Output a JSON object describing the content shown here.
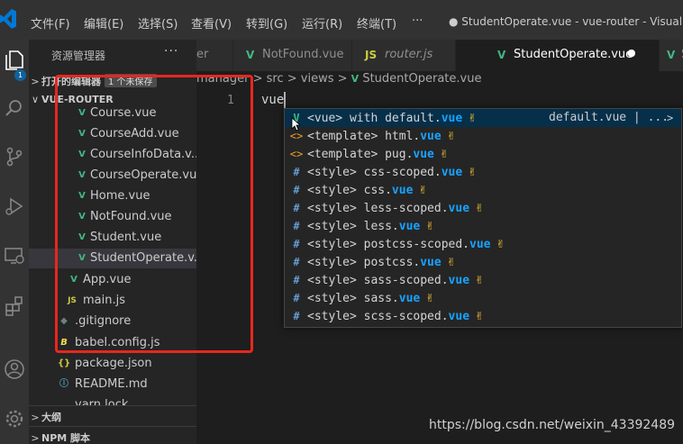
{
  "menu": [
    "文件(F)",
    "编辑(E)",
    "选择(S)",
    "查看(V)",
    "转到(G)",
    "运行(R)",
    "终端(T)",
    "···"
  ],
  "window_title": "● StudentOperate.vue - vue-router - Visual Stu",
  "activity": {
    "badge": "1"
  },
  "sidebar": {
    "header": "资源管理器",
    "more": "···",
    "open_editors": {
      "chevron": ">",
      "label": "打开的编辑器",
      "unsaved": "1 个未保存"
    },
    "project": {
      "chevron": "∨",
      "label": "VUE-ROUTER"
    },
    "files": [
      {
        "name": "Course.vue",
        "icon": "V"
      },
      {
        "name": "CourseAdd.vue",
        "icon": "V"
      },
      {
        "name": "CourseInfoData.v...",
        "icon": "V"
      },
      {
        "name": "CourseOperate.vue",
        "icon": "V"
      },
      {
        "name": "Home.vue",
        "icon": "V"
      },
      {
        "name": "NotFound.vue",
        "icon": "V"
      },
      {
        "name": "Student.vue",
        "icon": "V"
      },
      {
        "name": "StudentOperate.v...",
        "icon": "V"
      },
      {
        "name": "App.vue",
        "icon": "V"
      },
      {
        "name": "main.js",
        "icon": "JS"
      },
      {
        "name": ".gitignore",
        "icon": "◆"
      },
      {
        "name": "babel.config.js",
        "icon": "B"
      },
      {
        "name": "package.json",
        "icon": "{}"
      },
      {
        "name": "README.md",
        "icon": "ⓘ"
      },
      {
        "name": "yarn.lock",
        "icon": ""
      }
    ],
    "outline": {
      "chevron": ">",
      "label": "大纲"
    },
    "npm": {
      "chevron": ">",
      "label": "NPM 脚本"
    }
  },
  "tabs": [
    {
      "label": "er",
      "icon": ""
    },
    {
      "label": "NotFound.vue",
      "icon": "V"
    },
    {
      "label": "router.js",
      "icon": "JS"
    },
    {
      "label": "StudentOperate.vue",
      "icon": "V",
      "dirty": "●"
    },
    {
      "label": "S",
      "icon": "V"
    }
  ],
  "breadcrumb": [
    "manager",
    "src",
    "views",
    "StudentOperate.vue"
  ],
  "editor": {
    "line_number": "1",
    "code": "vue"
  },
  "suggest": {
    "items": [
      {
        "icon": "V",
        "pre": "<vue> with default.",
        "match": "vue",
        "detail": "default.vue | ...",
        "more": ">"
      },
      {
        "icon": "<>",
        "pre": "<template> html.",
        "match": "vue"
      },
      {
        "icon": "<>",
        "pre": "<template> pug.",
        "match": "vue"
      },
      {
        "icon": "#",
        "pre": "<style> css-scoped.",
        "match": "vue"
      },
      {
        "icon": "#",
        "pre": "<style> css.",
        "match": "vue"
      },
      {
        "icon": "#",
        "pre": "<style> less-scoped.",
        "match": "vue"
      },
      {
        "icon": "#",
        "pre": "<style> less.",
        "match": "vue"
      },
      {
        "icon": "#",
        "pre": "<style> postcss-scoped.",
        "match": "vue"
      },
      {
        "icon": "#",
        "pre": "<style> postcss.",
        "match": "vue"
      },
      {
        "icon": "#",
        "pre": "<style> sass-scoped.",
        "match": "vue"
      },
      {
        "icon": "#",
        "pre": "<style> sass.",
        "match": "vue"
      },
      {
        "icon": "#",
        "pre": "<style> scss-scoped.",
        "match": "vue"
      }
    ],
    "hand": "✌"
  },
  "watermark": "https://blog.csdn.net/weixin_43392489",
  "colors": {
    "accent": "#0e639c",
    "vue": "#41b883",
    "highlight": "#18a3ff",
    "annotation": "#e8271f"
  }
}
